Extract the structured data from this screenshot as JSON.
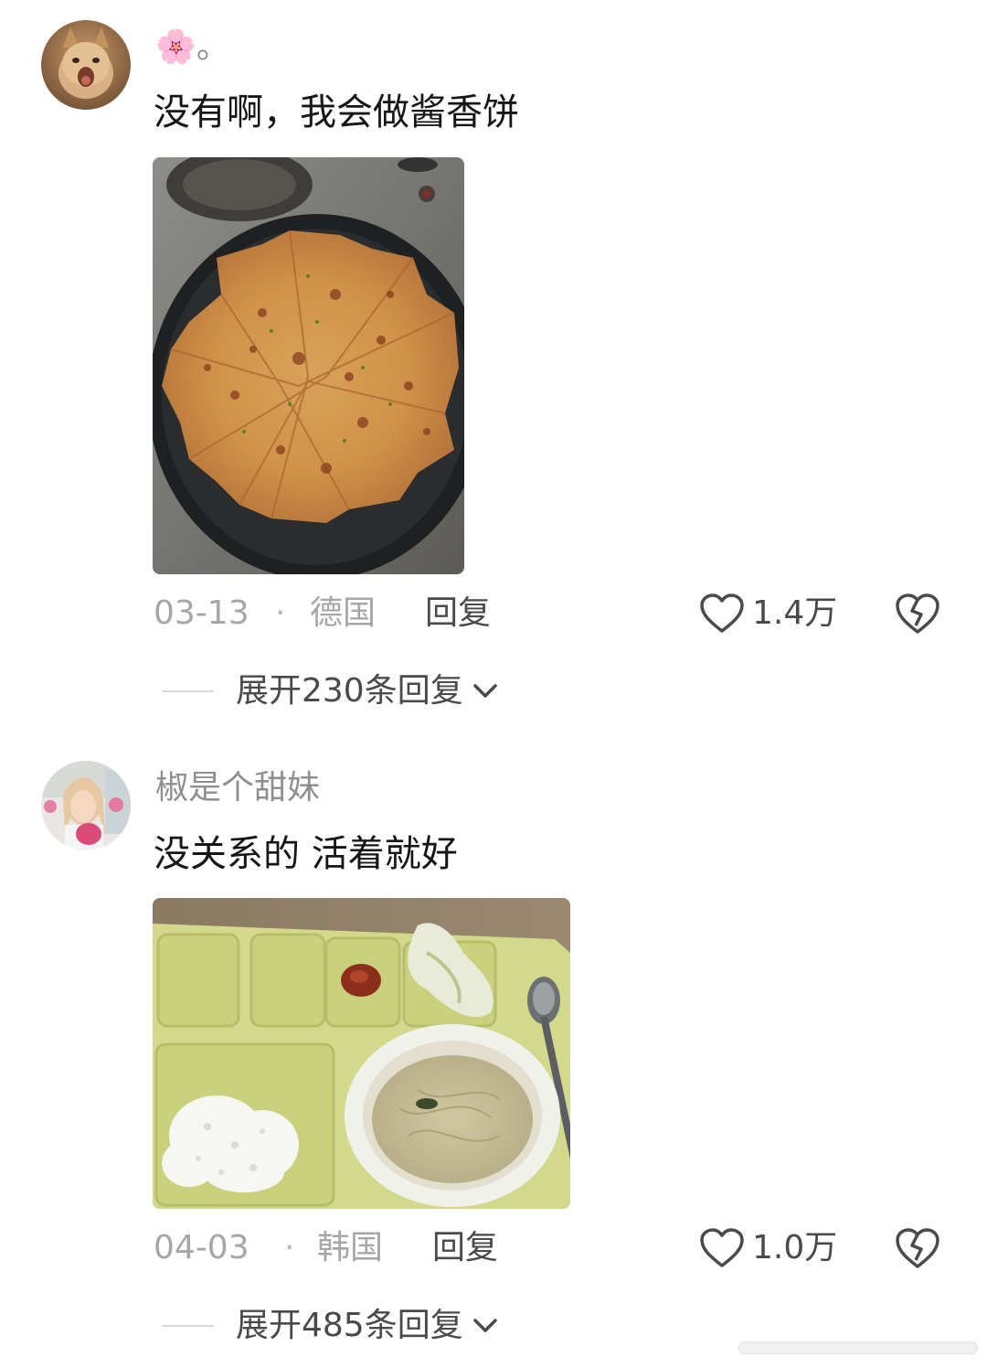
{
  "comments": [
    {
      "username": "🌸。",
      "text": "没有啊，我会做酱香饼",
      "date": "03-13",
      "separator": "·",
      "location": "德国",
      "reply_label": "回复",
      "likes": "1.4万",
      "expand_label": "展开230条回复",
      "photo": "pan-fried-sauce-pancake"
    },
    {
      "username": "椒是个甜妹",
      "text": "没关系的 活着就好",
      "date": "04-03",
      "separator": "·",
      "location": "韩国",
      "reply_label": "回复",
      "likes": "1.0万",
      "expand_label": "展开485条回复",
      "photo": "cafeteria-tray-rice-soup"
    }
  ],
  "icons": {
    "like": "heart-icon",
    "dislike": "broken-heart-icon",
    "expand": "chevron-down-icon"
  },
  "colors": {
    "text": "#161616",
    "muted": "#a6a6a6",
    "secondary": "#4a4a4a"
  }
}
